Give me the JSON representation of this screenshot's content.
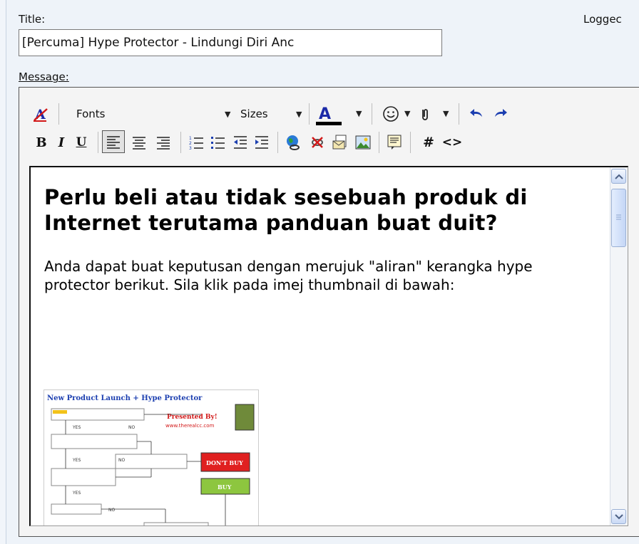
{
  "form": {
    "title_label": "Title:",
    "title_value": "[Percuma] Hype Protector - Lindungi Diri Anc",
    "logged_text": "Loggec",
    "message_label": "Message:"
  },
  "toolbar": {
    "fonts_label": "Fonts",
    "sizes_label": "Sizes",
    "bold_label": "B",
    "italic_label": "I",
    "underline_label": "U",
    "hash_label": "#",
    "code_label": "<>",
    "colors": {
      "text_color_bar": "#000000"
    }
  },
  "content": {
    "heading": "Perlu beli atau tidak sesebuah produk di Internet terutama panduan buat duit?",
    "paragraph": "Anda dapat buat keputusan dengan merujuk \"aliran\" kerangka hype protector berikut. Sila klik pada imej thumbnail di bawah:",
    "thumbnail": {
      "title": "New Product Launch + Hype Protector",
      "presented": "Presented By!",
      "site": "www.therealcc.com",
      "yes": "YES",
      "no": "NO",
      "dont_buy": "DON'T BUY",
      "buy": "BUY"
    }
  }
}
